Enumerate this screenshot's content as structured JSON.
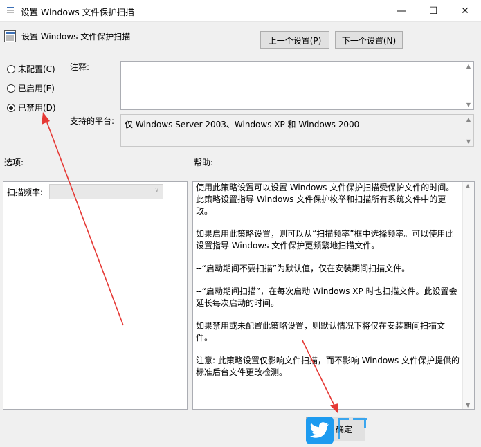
{
  "window": {
    "title": "设置 Windows 文件保护扫描",
    "minimize_glyph": "—",
    "maximize_glyph": "☐",
    "close_glyph": "✕"
  },
  "header": {
    "policy_title": "设置 Windows 文件保护扫描",
    "prev_button": "上一个设置(P)",
    "next_button": "下一个设置(N)"
  },
  "state": {
    "not_configured": "未配置(C)",
    "enabled": "已启用(E)",
    "disabled": "已禁用(D)",
    "selected": "disabled"
  },
  "comment": {
    "label": "注释:",
    "value": ""
  },
  "platform": {
    "label": "支持的平台:",
    "value": "仅 Windows Server 2003、Windows XP 和 Windows 2000"
  },
  "options": {
    "label": "选项:",
    "scan_frequency_label": "扫描频率:",
    "scan_frequency_value": ""
  },
  "help": {
    "label": "帮助:",
    "paragraphs": [
      "使用此策略设置可以设置 Windows 文件保护扫描受保护文件的时间。此策略设置指导 Windows 文件保护枚举和扫描所有系统文件中的更改。",
      "如果启用此策略设置，则可以从“扫描频率”框中选择频率。可以使用此设置指导 Windows 文件保护更频繁地扫描文件。",
      "--“启动期间不要扫描”为默认值，仅在安装期间扫描文件。",
      "--“启动期间扫描”，在每次启动 Windows XP 时也扫描文件。此设置会延长每次启动的时间。",
      "如果禁用或未配置此策略设置，则默认情况下将仅在安装期间扫描文件。",
      "注意: 此策略设置仅影响文件扫描，而不影响 Windows 文件保护提供的标准后台文件更改检测。"
    ]
  },
  "footer": {
    "ok_button_partial": "确定"
  },
  "colors": {
    "annotation_arrow": "#e53935",
    "watermark_blue": "#1d9bf0"
  }
}
